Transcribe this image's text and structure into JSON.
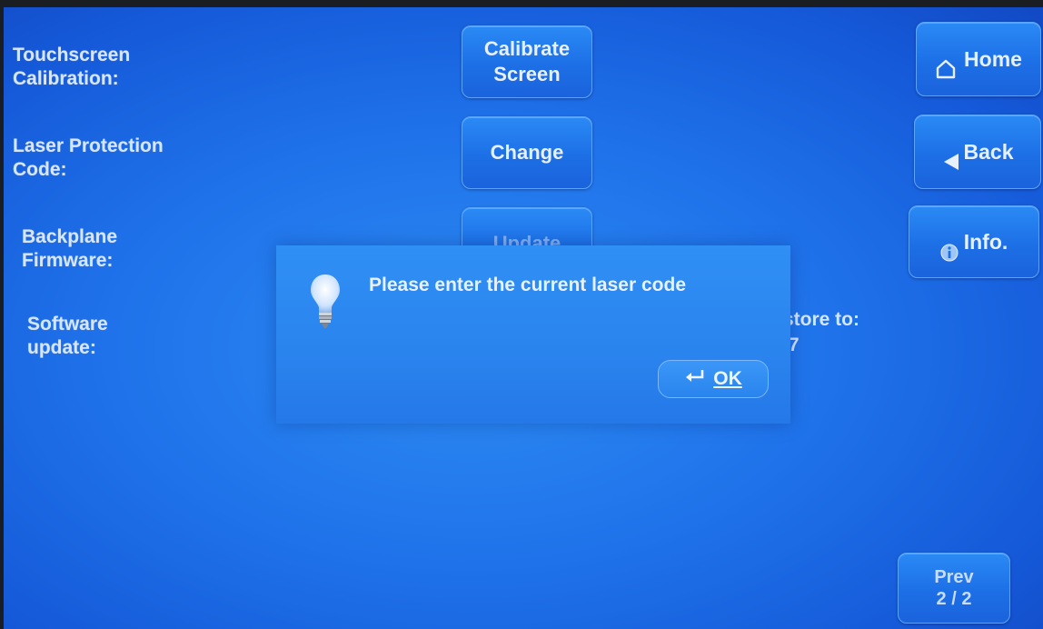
{
  "settings": {
    "rows": [
      {
        "label": "Touchscreen\nCalibration:",
        "button": "Calibrate\nScreen"
      },
      {
        "label": "Laser Protection\nCode:",
        "button": "Change"
      },
      {
        "label": "Backplane\nFirmware:",
        "button": "Update"
      },
      {
        "label": "Software\nupdate:"
      }
    ],
    "restore_partial": "store to:\n.7"
  },
  "nav": {
    "home": "Home",
    "back": "Back",
    "info": "Info.",
    "prev": "Prev\n2 / 2"
  },
  "dialog": {
    "message": "Please enter the current laser code",
    "ok": "OK"
  },
  "colors": {
    "screen_bg": "#1f72ea",
    "dialog_bg": "#2a84ee",
    "text": "#d7e6ff"
  },
  "icons": {
    "home": "house-outline-icon",
    "back": "left-triangle-icon",
    "info": "info-icon",
    "dialog": "lightbulb-icon",
    "ok": "enter-return-icon"
  }
}
